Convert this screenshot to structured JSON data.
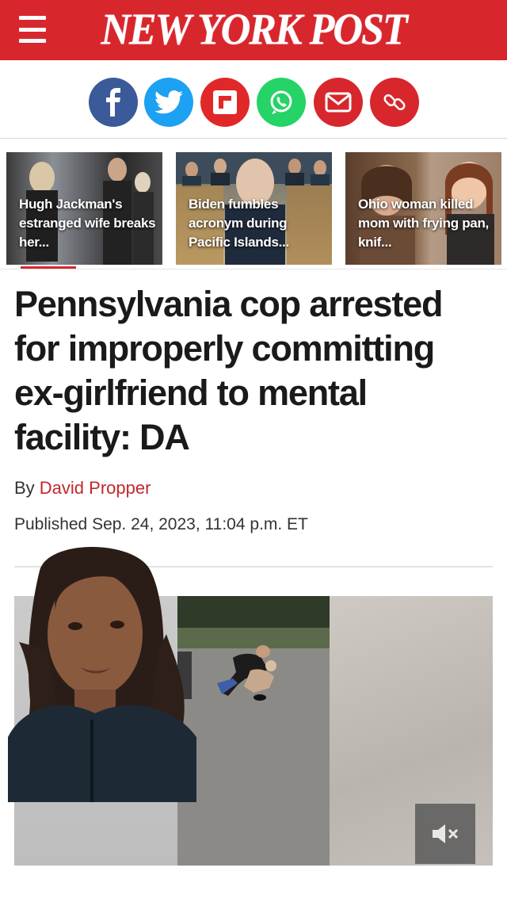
{
  "header": {
    "logo_text": "NEW YORK POST",
    "brand_color": "#d8262d",
    "menu_icon": "hamburger-menu-icon"
  },
  "share": {
    "buttons": [
      {
        "name": "facebook",
        "icon": "facebook-icon",
        "color": "#3b5a9a"
      },
      {
        "name": "twitter",
        "icon": "twitter-icon",
        "color": "#1da1f2"
      },
      {
        "name": "flipboard",
        "icon": "flipboard-icon",
        "color": "#e12828"
      },
      {
        "name": "whatsapp",
        "icon": "whatsapp-icon",
        "color": "#25d366"
      },
      {
        "name": "email",
        "icon": "email-icon",
        "color": "#d8262d"
      },
      {
        "name": "copy-link",
        "icon": "link-icon",
        "color": "#d8262d"
      }
    ]
  },
  "related": [
    {
      "caption": "Hugh Jackman's estranged wife breaks her..."
    },
    {
      "caption": "Biden fumbles acronym during Pacific Islands..."
    },
    {
      "caption": "Ohio woman killed mom with frying pan, knif..."
    }
  ],
  "article": {
    "headline": "Pennsylvania cop arrested for improperly committing ex-girlfriend to mental facility: DA",
    "byline_prefix": "By ",
    "author": "David Propper",
    "published": "Published Sep. 24, 2023, 11:04 p.m. ET"
  },
  "video": {
    "mute_icon": "speaker-muted-icon"
  }
}
